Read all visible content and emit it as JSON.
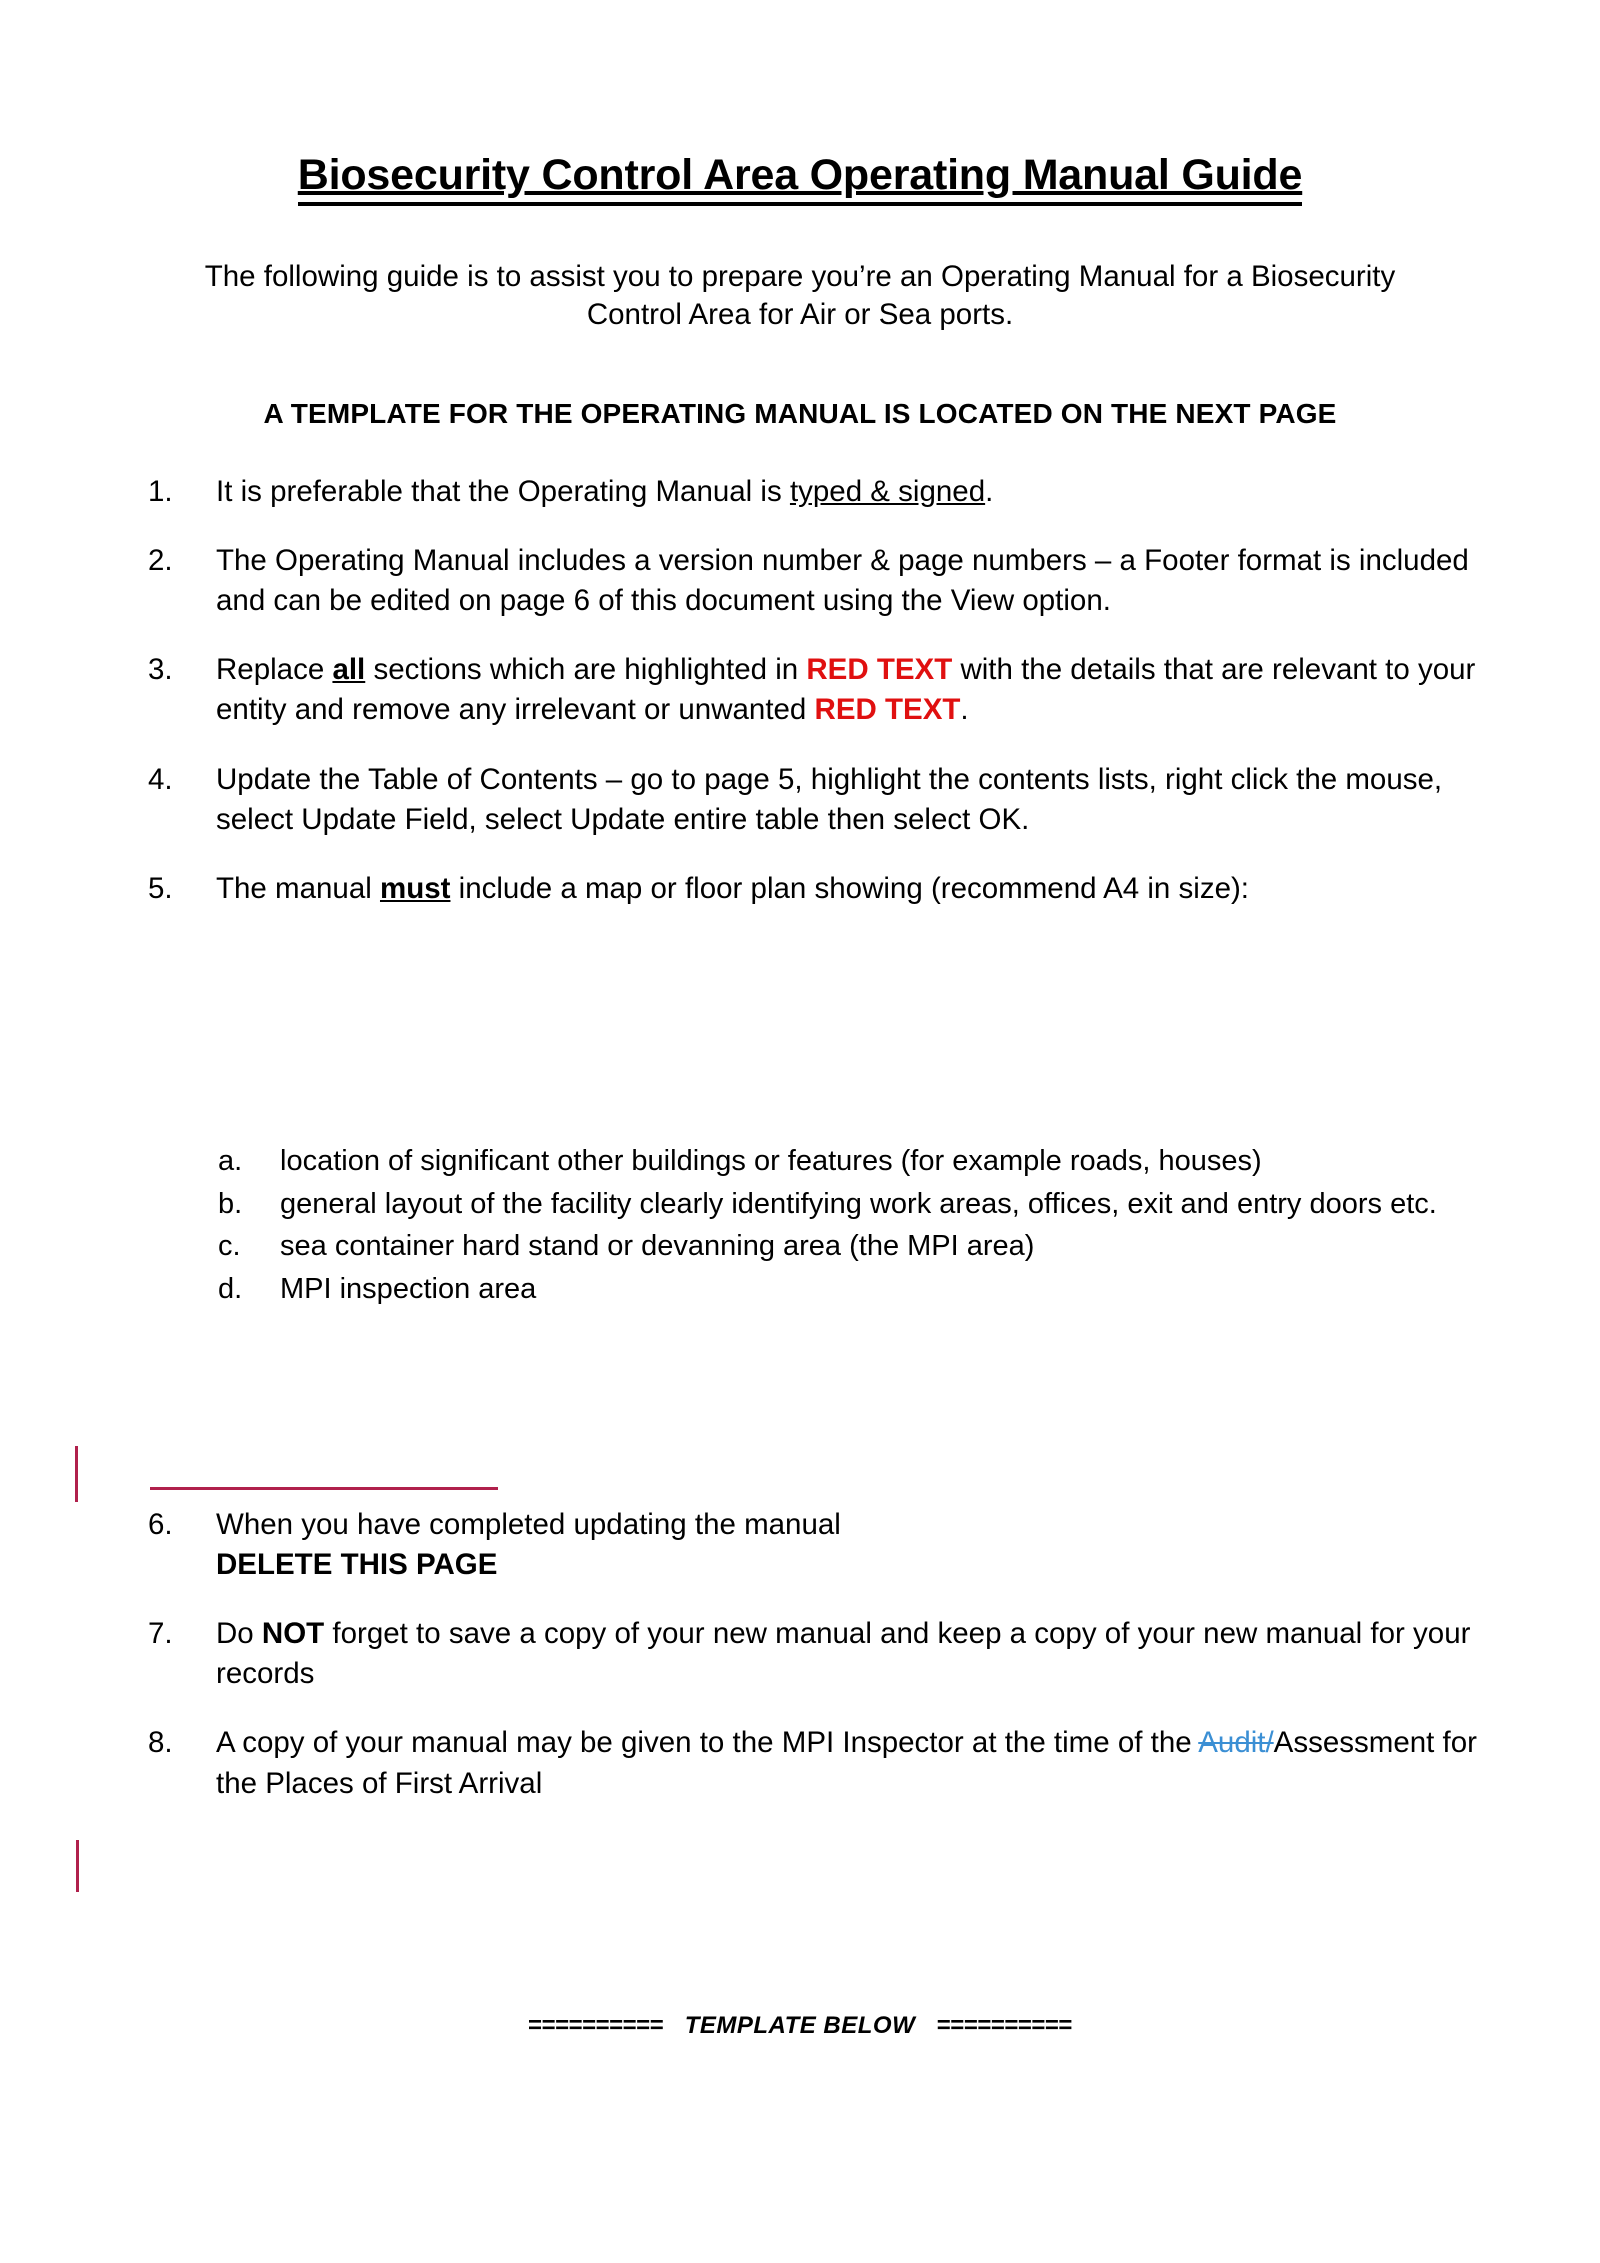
{
  "document": {
    "title": "Biosecurity Control Area Operating Manual Guide",
    "subtitle": "The following guide is to assist you to prepare you’re an Operating Manual for a Biosecurity Control Area for Air or Sea ports.",
    "notice": "A TEMPLATE FOR THE OPERATING MANUAL IS LOCATED ON THE NEXT PAGE"
  },
  "items": [
    {
      "marker": "1.",
      "segments": [
        {
          "text": "It is preferable that the Operating Manual is ",
          "style": "normal"
        },
        {
          "text": "typed & signed",
          "style": "underline"
        },
        {
          "text": ".",
          "style": "normal"
        }
      ]
    },
    {
      "marker": "2.",
      "segments": [
        {
          "text": "The Operating Manual includes a version number & page numbers – a Footer format is included and can be edited on page 6 of this document using the View option.",
          "style": "normal"
        }
      ]
    },
    {
      "marker": "3.",
      "segments": [
        {
          "text": "Replace ",
          "style": "normal"
        },
        {
          "text": "all",
          "style": "bold-underline"
        },
        {
          "text": " sections which are highlighted in ",
          "style": "normal"
        },
        {
          "text": "RED TEXT",
          "style": "red"
        },
        {
          "text": " with the details that are relevant to your entity and remove any irrelevant or unwanted ",
          "style": "normal"
        },
        {
          "text": "RED TEXT",
          "style": "red"
        },
        {
          "text": ".",
          "style": "normal"
        }
      ]
    },
    {
      "marker": "4.",
      "segments": [
        {
          "text": "Update the Table of Contents – go to page 5, highlight the contents lists, right click the mouse, select Update Field, select Update entire table then select OK.",
          "style": "normal"
        }
      ]
    },
    {
      "marker": "5.",
      "segments": [
        {
          "text": "The manual ",
          "style": "normal"
        },
        {
          "text": "must",
          "style": "bold-underline"
        },
        {
          "text": " include a map or floor plan showing (recommend A4 in size):",
          "style": "normal"
        }
      ]
    }
  ],
  "subitems": [
    {
      "marker": "a.",
      "text": "location of significant other buildings or features (for example roads, houses)"
    },
    {
      "marker": "b.",
      "text": "general layout of the facility clearly identifying work areas, offices, exit and entry doors etc."
    },
    {
      "marker": "c.",
      "text": "sea container hard stand or devanning area (the MPI area)"
    },
    {
      "marker": "d.",
      "text": "MPI inspection area"
    }
  ],
  "items2": [
    {
      "marker": "6.",
      "segments": [
        {
          "text": "When you have completed updating the manual",
          "style": "normal"
        },
        {
          "text": "BREAK",
          "style": "break"
        },
        {
          "text": "DELETE THIS PAGE",
          "style": "bold"
        }
      ]
    },
    {
      "marker": "7.",
      "segments": [
        {
          "text": "Do ",
          "style": "normal"
        },
        {
          "text": "NOT",
          "style": "bold"
        },
        {
          "text": " forget to save a copy of your new manual and keep a copy of your new manual for your records",
          "style": "normal"
        }
      ]
    },
    {
      "marker": "8.",
      "segments": [
        {
          "text": "A copy of your manual may be given to the MPI Inspector at the time of the ",
          "style": "normal"
        },
        {
          "text": "Audit/",
          "style": "strikethrough"
        },
        {
          "text": "Assessment for the Places of First Arrival",
          "style": "normal"
        }
      ]
    }
  ],
  "footer": {
    "left_rule": "==========",
    "label": "TEMPLATE BELOW",
    "right_rule": "=========="
  },
  "colors": {
    "red_text": "#E01010",
    "change_bar": "#B0204C",
    "deleted_text": "#3B8FD4",
    "body_text": "#000000",
    "page_background": "#FFFFFF"
  }
}
